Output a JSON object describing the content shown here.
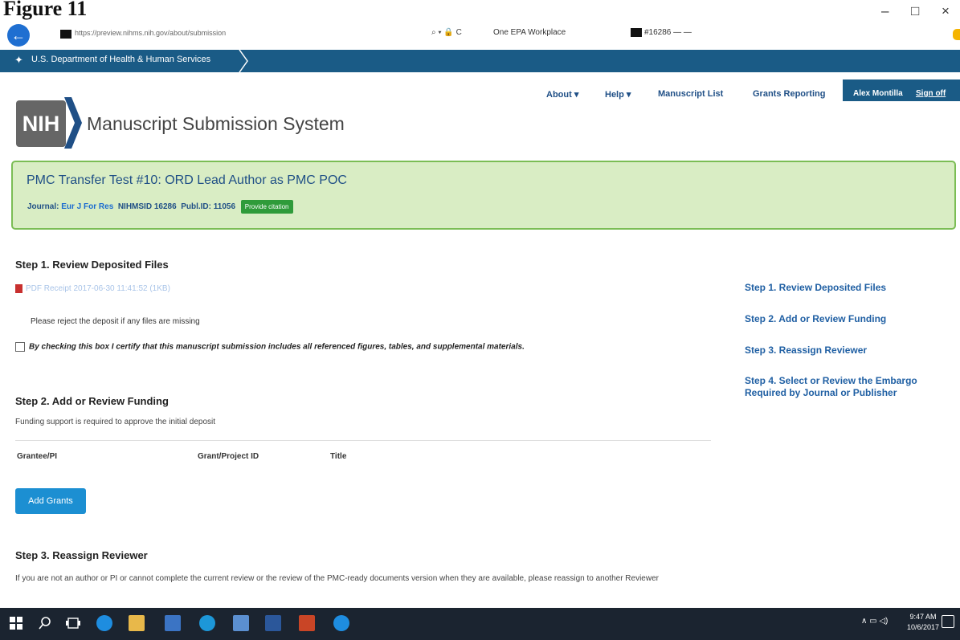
{
  "page_heading": "Figure 11",
  "window_controls": {
    "minimize": "–",
    "restore": "□",
    "close": "×"
  },
  "browser": {
    "url": "https://preview.nihms.nih.gov/about/submission",
    "address_icons": "⌕ ▾ 🔒 C",
    "tab1": "One EPA Workplace",
    "tab2": "#16286 — —"
  },
  "hhs": {
    "label": "U.S. Department of Health & Human Services"
  },
  "header": {
    "logo_text": "NIH",
    "site_title": "Manuscript Submission System",
    "nav": [
      {
        "label": "About ▾"
      },
      {
        "label": "Help ▾"
      },
      {
        "label": "Manuscript List"
      },
      {
        "label": "Grants Reporting"
      }
    ],
    "user_name": "Alex Montilla",
    "sign_off": "Sign off"
  },
  "manuscript": {
    "title": "PMC Transfer Test #10: ORD Lead Author as PMC POC",
    "journal_label": "Journal:",
    "journal_name": "Eur J For Res",
    "nihmsid": "NIHMSID 16286",
    "publid": "Publ.ID: 11056",
    "provide_citation": "Provide citation"
  },
  "step1": {
    "heading": "Step 1. Review Deposited Files",
    "pdf_link": "PDF Receipt 2017-06-30 11:41:52 (1KB)",
    "reject_note": "Please reject the deposit if any files are missing",
    "certify_text": "By checking this box I certify that this manuscript submission includes all referenced figures, tables, and supplemental materials."
  },
  "step2": {
    "heading": "Step 2. Add or Review Funding",
    "note": "Funding support is required to approve the initial deposit",
    "columns": [
      "Grantee/PI",
      "Grant/Project ID",
      "Title"
    ],
    "add_grants": "Add Grants"
  },
  "step3": {
    "heading": "Step 3. Reassign Reviewer",
    "note": "If you are not an author or PI or cannot complete the current review or the review of the PMC-ready documents version when they are available, please reassign to another Reviewer"
  },
  "side_nav": [
    {
      "label": "Step 1. Review Deposited Files"
    },
    {
      "label": "Step 2. Add or Review Funding"
    },
    {
      "label": "Step 3. Reassign Reviewer"
    },
    {
      "label": "Step 4. Select or Review the Embargo Required by Journal or Publisher"
    }
  ],
  "taskbar": {
    "tray": "∧ ▭ ◁)",
    "time": "9:47 AM",
    "date": "10/6/2017"
  }
}
